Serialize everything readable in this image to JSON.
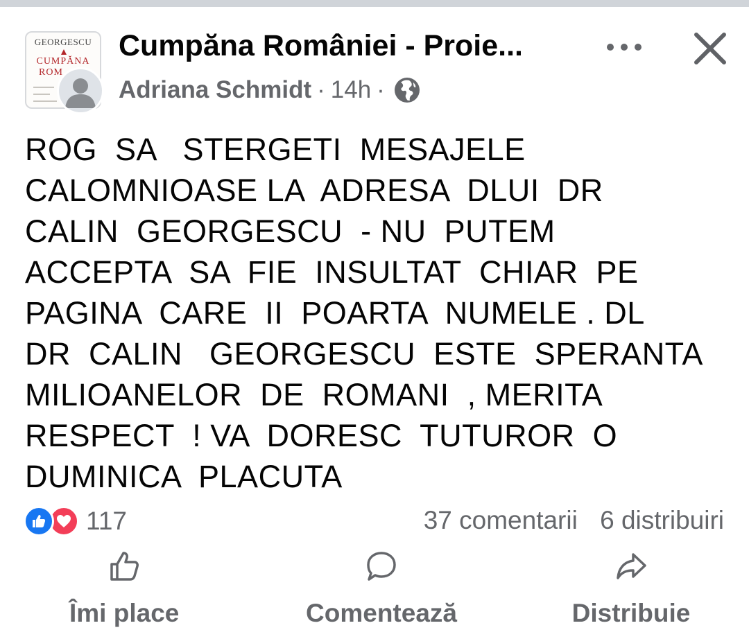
{
  "post": {
    "page_name": "Cumpăna României - Proie...",
    "author": "Adriana Schmidt",
    "time": "14h",
    "separator": "·",
    "page_avatar": {
      "author_text": "GEORGESCU",
      "title_line1": "CUMPĂNA",
      "title_line2": "ROM"
    },
    "text": "ROG  SA   STERGETI  MESAJELE\nCALOMNIOASE LA  ADRESA  DLUI  DR\nCALIN  GEORGESCU  - NU  PUTEM\nACCEPTA  SA  FIE  INSULTAT  CHIAR  PE\nPAGINA  CARE  II  POARTA  NUMELE . DL\nDR  CALIN   GEORGESCU  ESTE  SPERANTA\nMILIOANELOR  DE  ROMANI  , MERITA\nRESPECT  ! VA  DORESC  TUTUROR  O\nDUMINICA  PLACUTA"
  },
  "reactions": {
    "count": "117",
    "comments": "37 comentarii",
    "shares": "6 distribuiri"
  },
  "actions": {
    "like": "Îmi place",
    "comment": "Comentează",
    "share": "Distribuie"
  },
  "icons": {
    "more": "more-options-icon",
    "close": "close-icon",
    "globe": "globe-icon",
    "like_reaction": "like-reaction-icon",
    "love_reaction": "love-reaction-icon",
    "like": "thumbs-up-icon",
    "comment": "comment-bubble-icon",
    "share": "share-arrow-icon"
  },
  "colors": {
    "text": "#050505",
    "secondary": "#65676b",
    "like_blue": "#1877f2",
    "love_red": "#f33e58",
    "book_red": "#b3262a"
  }
}
